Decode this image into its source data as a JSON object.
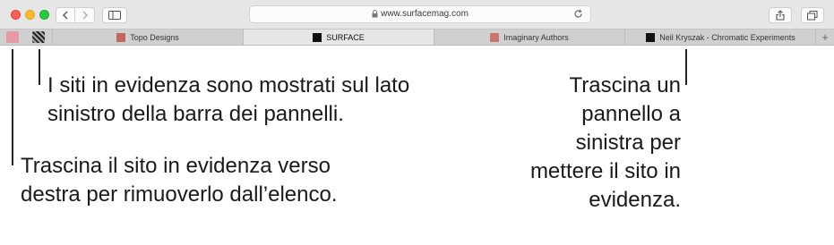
{
  "browser": {
    "url": "www.surfacemag.com",
    "pinned_tabs": [
      "pinned-site-1",
      "pinned-site-2"
    ],
    "tabs": [
      {
        "label": "Topo Designs",
        "active": false,
        "favicon_color": "#c0392b"
      },
      {
        "label": "SURFACE",
        "active": true,
        "favicon_color": "#111111"
      },
      {
        "label": "Imaginary Authors",
        "active": false,
        "favicon_color": "#c0392b"
      },
      {
        "label": "Neil Kryszak - Chromatic Experiments",
        "active": false,
        "favicon_color": "#111111"
      }
    ],
    "new_tab_symbol": "+"
  },
  "callouts": {
    "pinned_position": "I siti in evidenza sono mostrati sul lato sinistro della barra dei pannelli.",
    "drag_remove": "Trascina il sito in evidenza verso destra per rimuoverlo dall’elenco.",
    "drag_pin": "Trascina un pannello a sinistra per mettere il sito in evidenza."
  },
  "colors": {
    "toolbar_bg": "#e7e6e7",
    "tabbar_bg": "#d1d0d1",
    "close": "#fe5f57",
    "minimize": "#febc2e",
    "zoom": "#28c840"
  }
}
